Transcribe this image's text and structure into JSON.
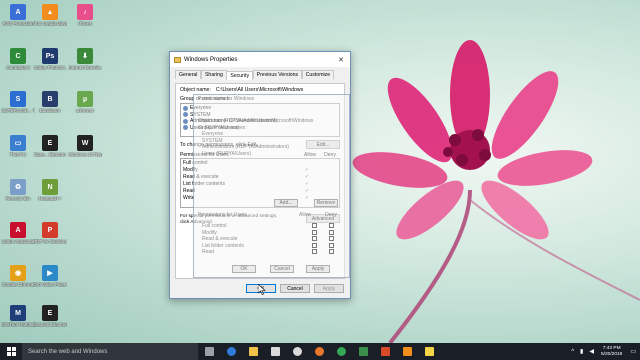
{
  "desktop": {
    "icons": [
      {
        "label": "AVG Protection",
        "color": "#3a6fd8",
        "glyph": "A"
      },
      {
        "label": "VLC media player",
        "color": "#f28c1c",
        "glyph": "▲"
      },
      {
        "label": "iTunes",
        "color": "#e84e8a",
        "glyph": "♪"
      },
      {
        "label": "Camtasia 9",
        "color": "#2e8b3c",
        "glyph": "C"
      },
      {
        "label": "Adobe Photosh...",
        "color": "#1f3b6e",
        "glyph": "Ps"
      },
      {
        "label": "Internet Downlo...",
        "color": "#3b8a3b",
        "glyph": "⬇"
      },
      {
        "label": "SUPERAntiS... Tools",
        "color": "#2b6dd0",
        "glyph": "S"
      },
      {
        "label": "Bandicam",
        "color": "#2a3e6c",
        "glyph": "B"
      },
      {
        "label": "µTorrent",
        "color": "#6aa84f",
        "glyph": "µ"
      },
      {
        "label": "This PC",
        "color": "#3a7fd0",
        "glyph": "▭"
      },
      {
        "label": "Easy... Electron",
        "color": "#222222",
        "glyph": "E"
      },
      {
        "label": "Windows 10 Repa...",
        "color": "#222222",
        "glyph": "W"
      },
      {
        "label": "Recycle Bin",
        "color": "#7b9fc9",
        "glyph": "♻"
      },
      {
        "label": "Notepad++",
        "color": "#6e9e3a",
        "glyph": "N"
      },
      {
        "label": "Adobe Applicatio...",
        "color": "#c8102e",
        "glyph": "A"
      },
      {
        "label": "PDF for Explorer",
        "color": "#d43b2c",
        "glyph": "P"
      },
      {
        "label": "Google Chrome",
        "color": "#e5a01a",
        "glyph": "◉"
      },
      {
        "label": "Orb Video Player",
        "color": "#2b89c7",
        "glyph": "▶"
      },
      {
        "label": "MiniTool Partition",
        "color": "#1e3f7a",
        "glyph": "M"
      },
      {
        "label": "EaseUS Electron (2)",
        "color": "#222222",
        "glyph": "E"
      }
    ]
  },
  "window": {
    "title": "Windows Properties",
    "close": "✕",
    "tabs": [
      "General",
      "Sharing",
      "Security",
      "Previous Versions",
      "Customize"
    ],
    "active_tab": "Security",
    "object_name_label": "Object name:",
    "object_name_value": "C:\\Users\\All Users\\Microsoft\\Windows",
    "group_label": "Group or user names:",
    "users": [
      "Everyone",
      "SYSTEM",
      "Administrators (RUPYA\\Administrators)",
      "Users (RUPYA\\Users)"
    ],
    "change_note": "To change permissions, click Edit.",
    "edit_button": "Edit...",
    "permissions_label": "Permissions for Users",
    "allow_header": "Allow",
    "deny_header": "Deny",
    "permissions": [
      {
        "name": "Full control",
        "allow": "",
        "deny": ""
      },
      {
        "name": "Modify",
        "allow": "✓",
        "deny": ""
      },
      {
        "name": "Read & execute",
        "allow": "✓",
        "deny": ""
      },
      {
        "name": "List folder contents",
        "allow": "✓",
        "deny": ""
      },
      {
        "name": "Read",
        "allow": "✓",
        "deny": ""
      },
      {
        "name": "Write",
        "allow": "✓",
        "deny": ""
      }
    ],
    "advanced_note": "For special permissions or advanced settings, click Advanced.",
    "advanced_button": "Advanced",
    "ok": "OK",
    "cancel": "Cancel",
    "apply": "Apply"
  },
  "ghost_dialog": {
    "title": "Permissions for Windows",
    "object_name": "Object name:   C:\\Users\\All Users\\Microsoft\\Windows",
    "group_label": "Group or user names:",
    "users": [
      "Everyone",
      "SYSTEM",
      "Administrators (RUPYA\\Administrators)",
      "Users (RUPYA\\Users)"
    ],
    "add": "Add...",
    "remove": "Remove",
    "perms_label": "Permissions for Users",
    "allow": "Allow",
    "deny": "Deny",
    "perms": [
      "Full control",
      "Modify",
      "Read & execute",
      "List folder contents",
      "Read"
    ],
    "ok": "OK",
    "cancel": "Cancel",
    "apply": "Apply"
  },
  "taskbar": {
    "search_placeholder": "Search the web and Windows",
    "apps": [
      {
        "name": "task-view",
        "color": "#9aa0a6"
      },
      {
        "name": "edge",
        "color": "#2f7bd8"
      },
      {
        "name": "file-explorer",
        "color": "#f0c24a"
      },
      {
        "name": "store",
        "color": "#d9d9d9"
      },
      {
        "name": "media",
        "color": "#d9d9d9"
      },
      {
        "name": "firefox",
        "color": "#e8762b"
      },
      {
        "name": "chrome",
        "color": "#34a853"
      },
      {
        "name": "camtasia",
        "color": "#3a8f4a"
      },
      {
        "name": "recorder",
        "color": "#d84b2a"
      },
      {
        "name": "vlc",
        "color": "#f28c1c"
      },
      {
        "name": "notes",
        "color": "#f5d547"
      }
    ],
    "time": "7:43 PM",
    "date": "5/20/2018"
  }
}
